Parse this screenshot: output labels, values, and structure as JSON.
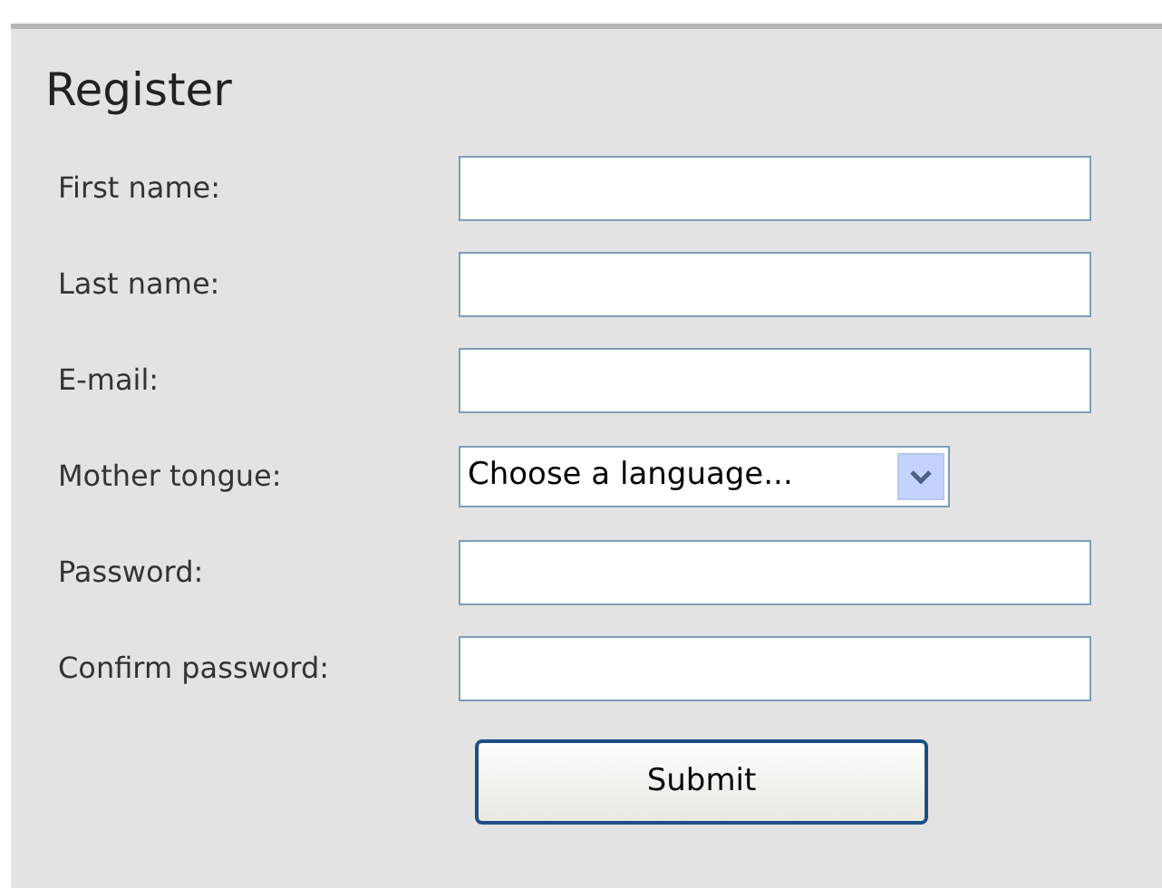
{
  "title": "Register",
  "fields": [
    {
      "label": "First name:",
      "kind": "text"
    },
    {
      "label": "Last name:",
      "kind": "text"
    },
    {
      "label": "E-mail:",
      "kind": "text"
    },
    {
      "label": "Mother tongue:",
      "kind": "select",
      "value": "Choose a language..."
    },
    {
      "label": "Password:",
      "kind": "text"
    },
    {
      "label": "Confirm password:",
      "kind": "text"
    }
  ],
  "submit": "Submit"
}
